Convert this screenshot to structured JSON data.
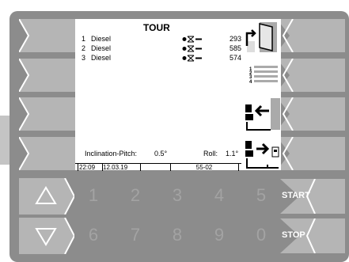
{
  "screen": {
    "title": "TOUR",
    "rows": [
      {
        "index": "1",
        "product": "Diesel",
        "quantity": "293"
      },
      {
        "index": "2",
        "product": "Diesel",
        "quantity": "585"
      },
      {
        "index": "3",
        "product": "Diesel",
        "quantity": "574"
      }
    ],
    "list_icon_numbers": [
      "1",
      "2",
      "3",
      "4"
    ],
    "inclination_label": "Inclination-Pitch:",
    "inclination_value": "0.5°",
    "roll_label": "Roll:",
    "roll_value": "1.1°",
    "status": {
      "time": "22:09",
      "date": "12.03.19",
      "empty": "",
      "code": "55-02",
      "empty2": ""
    }
  },
  "keypad": {
    "top_row": [
      "1",
      "2",
      "3",
      "4",
      "5"
    ],
    "bottom_row": [
      "6",
      "7",
      "8",
      "9",
      "0"
    ]
  },
  "buttons": {
    "start": "START",
    "stop": "STOP"
  },
  "colors": {
    "device": "#8c8c8c",
    "key_fill": "#b5b5b5",
    "digit": "#a3a3a3"
  }
}
